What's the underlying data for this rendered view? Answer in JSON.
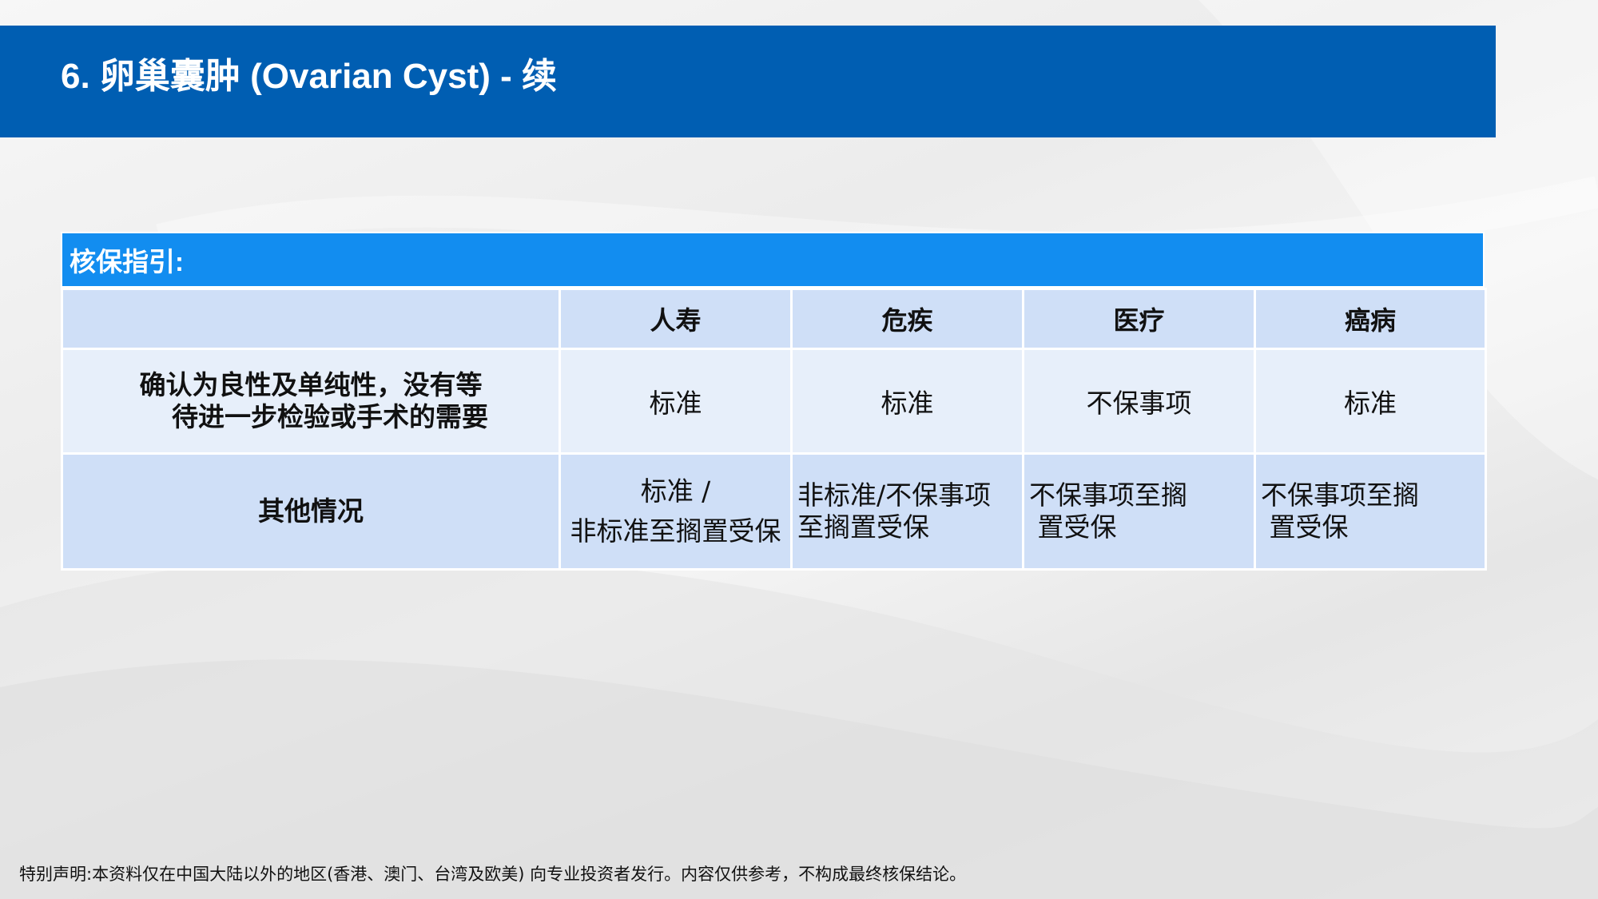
{
  "slide": {
    "title": "6. 卵巢囊肿 (Ovarian Cyst) - 续",
    "colors": {
      "title_bar": "#005eb2",
      "panel_header": "#128df0",
      "cell_dark": "#cfdff7",
      "cell_light": "#e7effa"
    }
  },
  "guide": {
    "header": "核保指引:",
    "columns": [
      "",
      "人寿",
      "危疾",
      "医疗",
      "癌病"
    ],
    "rows": [
      {
        "label_lines": [
          "确认为良性及单纯性，没有等",
          "待进一步检验或手术的需要"
        ],
        "cells": [
          "标准",
          "标准",
          "不保事项",
          "标准"
        ]
      },
      {
        "label": "其他情况",
        "cells": [
          [
            "标准 /",
            "非标准至搁置受保"
          ],
          [
            "非标准/不保事项",
            "至搁置受保"
          ],
          [
            "不保事项至搁",
            " 置受保"
          ],
          [
            "不保事项至搁",
            " 置受保"
          ]
        ]
      }
    ]
  },
  "footer": {
    "disclaimer": "特别声明:本资料仅在中国大陆以外的地区(香港、澳门、台湾及欧美) 向专业投资者发行。内容仅供参考，不构成最终核保结论。"
  }
}
